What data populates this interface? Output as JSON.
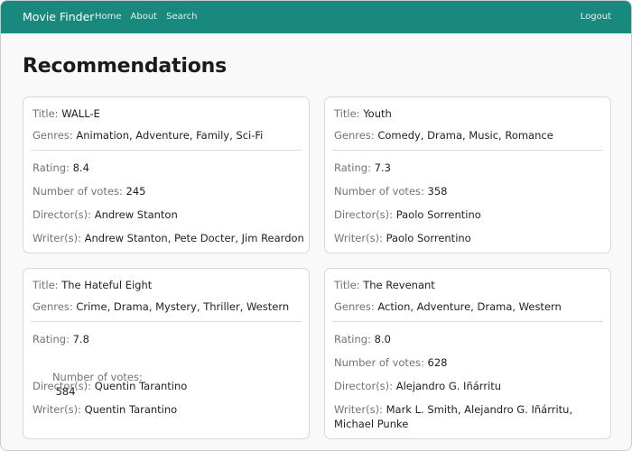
{
  "navbar": {
    "brand": "Movie Finder",
    "links": [
      "Home",
      "About",
      "Search"
    ],
    "logout": "Logout"
  },
  "main": {
    "title": "Recommendations"
  },
  "labels": {
    "title": "Title:",
    "genres": "Genres:",
    "rating": "Rating:",
    "votes": "Number of votes:",
    "directors": "Director(s):",
    "writers": "Writer(s):"
  },
  "movies": [
    {
      "title": "WALL-E",
      "genres": "Animation, Adventure, Family, Sci-Fi",
      "rating": "8.4",
      "votes": "245",
      "directors": "Andrew Stanton",
      "writers": "Andrew Stanton, Pete Docter, Jim Reardon"
    },
    {
      "title": "Youth",
      "genres": "Comedy, Drama, Music, Romance",
      "rating": "7.3",
      "votes": "358",
      "directors": "Paolo Sorrentino",
      "writers": "Paolo Sorrentino"
    },
    {
      "title": "The Hateful Eight",
      "genres": "Crime, Drama, Mystery, Thriller, Western",
      "rating": "7.8",
      "votes": " 584",
      "directors": "Quentin Tarantino",
      "writers": "Quentin Tarantino"
    },
    {
      "title": "The Revenant",
      "genres": "Action, Adventure, Drama, Western",
      "rating": "8.0",
      "votes": "628",
      "directors": "Alejandro G. Iñárritu",
      "writers": "Mark L. Smith, Alejandro G. Iñárritu, Michael Punke"
    }
  ]
}
